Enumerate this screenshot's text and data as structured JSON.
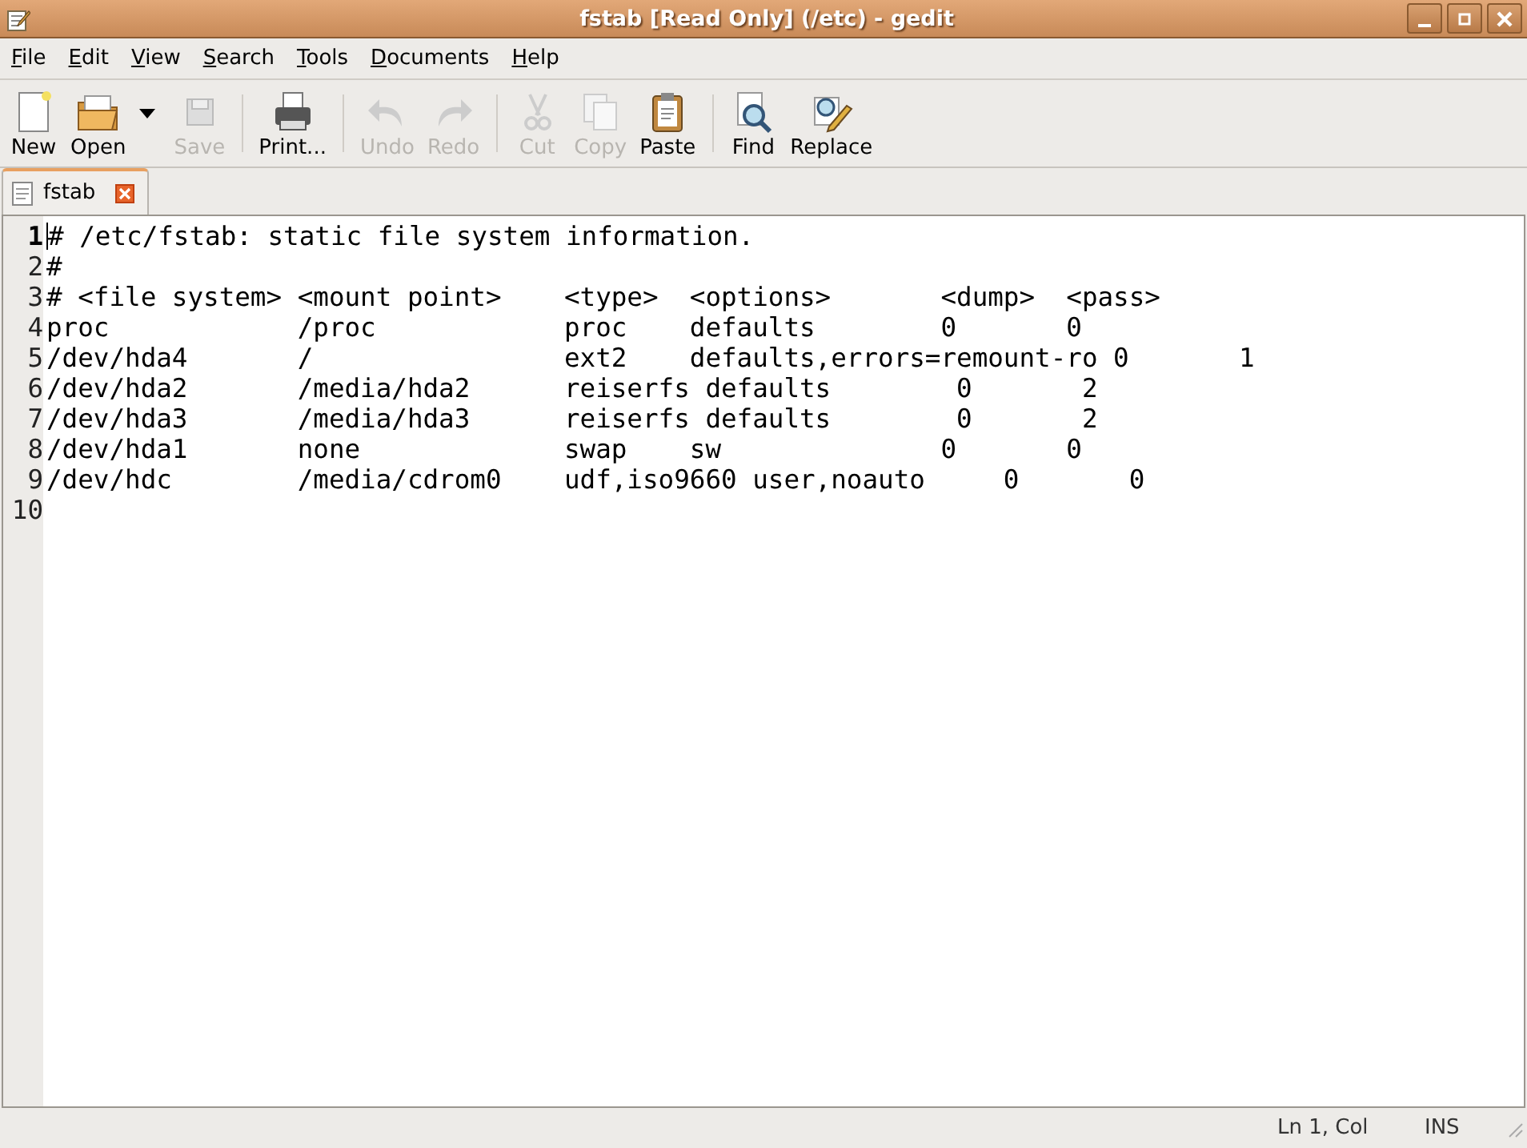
{
  "window": {
    "title": "fstab [Read Only] (/etc) - gedit"
  },
  "menu": [
    "File",
    "Edit",
    "View",
    "Search",
    "Tools",
    "Documents",
    "Help"
  ],
  "toolbar": [
    {
      "kind": "button",
      "label": "New",
      "disabled": false
    },
    {
      "kind": "button",
      "label": "Open",
      "disabled": false
    },
    {
      "kind": "dropdown",
      "disabled": false
    },
    {
      "kind": "button",
      "label": "Save",
      "disabled": true
    },
    {
      "kind": "separator"
    },
    {
      "kind": "button",
      "label": "Print...",
      "disabled": false
    },
    {
      "kind": "separator"
    },
    {
      "kind": "button",
      "label": "Undo",
      "disabled": true
    },
    {
      "kind": "button",
      "label": "Redo",
      "disabled": true
    },
    {
      "kind": "separator"
    },
    {
      "kind": "button",
      "label": "Cut",
      "disabled": true
    },
    {
      "kind": "button",
      "label": "Copy",
      "disabled": true
    },
    {
      "kind": "button",
      "label": "Paste",
      "disabled": false
    },
    {
      "kind": "separator"
    },
    {
      "kind": "button",
      "label": "Find",
      "disabled": false
    },
    {
      "kind": "button",
      "label": "Replace",
      "disabled": false
    }
  ],
  "tabs": [
    {
      "label": "fstab",
      "selected": true
    }
  ],
  "editor": {
    "lines": [
      {
        "number": "1",
        "text": "# /etc/fstab: static file system information.",
        "current": true
      },
      {
        "number": "2",
        "text": "#",
        "current": false
      },
      {
        "number": "3",
        "text": "# <file system> <mount point>    <type>  <options>       <dump>  <pass>",
        "current": false
      },
      {
        "number": "4",
        "text": "proc            /proc            proc    defaults        0       0",
        "current": false
      },
      {
        "number": "5",
        "text": "/dev/hda4       /                ext2    defaults,errors=remount-ro 0       1",
        "current": false
      },
      {
        "number": "6",
        "text": "/dev/hda2       /media/hda2      reiserfs defaults        0       2",
        "current": false
      },
      {
        "number": "7",
        "text": "/dev/hda3       /media/hda3      reiserfs defaults        0       2",
        "current": false
      },
      {
        "number": "8",
        "text": "/dev/hda1       none             swap    sw              0       0",
        "current": false
      },
      {
        "number": "9",
        "text": "/dev/hdc        /media/cdrom0    udf,iso9660 user,noauto     0       0",
        "current": false
      },
      {
        "number": "10",
        "current": false
      }
    ]
  },
  "status_bar": {
    "position": "Ln 1, Col",
    "mode": "INS"
  }
}
